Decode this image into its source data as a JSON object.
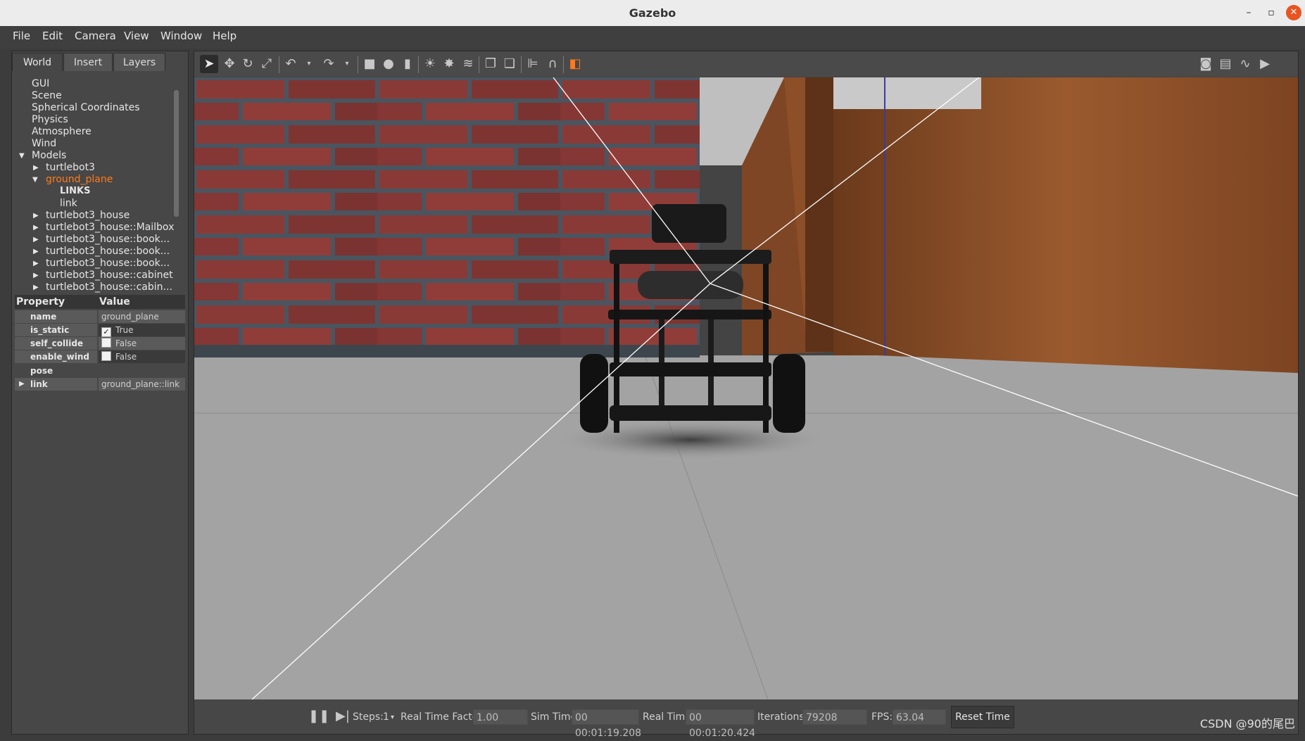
{
  "window": {
    "title": "Gazebo",
    "minimize": "–",
    "maximize": "▫",
    "close": "✕"
  },
  "menu": [
    "File",
    "Edit",
    "Camera",
    "View",
    "Window",
    "Help"
  ],
  "left_tabs": [
    "World",
    "Insert",
    "Layers"
  ],
  "tree": {
    "items": [
      "GUI",
      "Scene",
      "Spherical Coordinates",
      "Physics",
      "Atmosphere",
      "Wind",
      "Models"
    ],
    "models": [
      "turtlebot3",
      "ground_plane",
      "turtlebot3_house",
      "turtlebot3_house::Mailbox",
      "turtlebot3_house::book...",
      "turtlebot3_house::book...",
      "turtlebot3_house::book...",
      "turtlebot3_house::cabinet",
      "turtlebot3_house::cabin..."
    ],
    "links_header": "LINKS",
    "link_item": "link"
  },
  "properties": {
    "header_property": "Property",
    "header_value": "Value",
    "rows": [
      {
        "name": "name",
        "value": "ground_plane"
      },
      {
        "name": "is_static",
        "value": "True",
        "check": "✓"
      },
      {
        "name": "self_collide",
        "value": "False",
        "check": ""
      },
      {
        "name": "enable_wind",
        "value": "False",
        "check": ""
      },
      {
        "name": "pose",
        "value": ""
      },
      {
        "name": "link",
        "value": "ground_plane::link"
      }
    ]
  },
  "status": {
    "steps_label": "Steps:",
    "steps_value": "1",
    "rtf_label": "Real Time Factor:",
    "rtf_value": "1.00",
    "sim_label": "Sim Time:",
    "sim_value": "00 00:01:19.208",
    "real_label": "Real Time:",
    "real_value": "00 00:01:20.424",
    "iter_label": "Iterations:",
    "iter_value": "79208",
    "fps_label": "FPS:",
    "fps_value": "63.04",
    "reset_label": "Reset Time"
  },
  "watermark": "CSDN @90的尾巴"
}
